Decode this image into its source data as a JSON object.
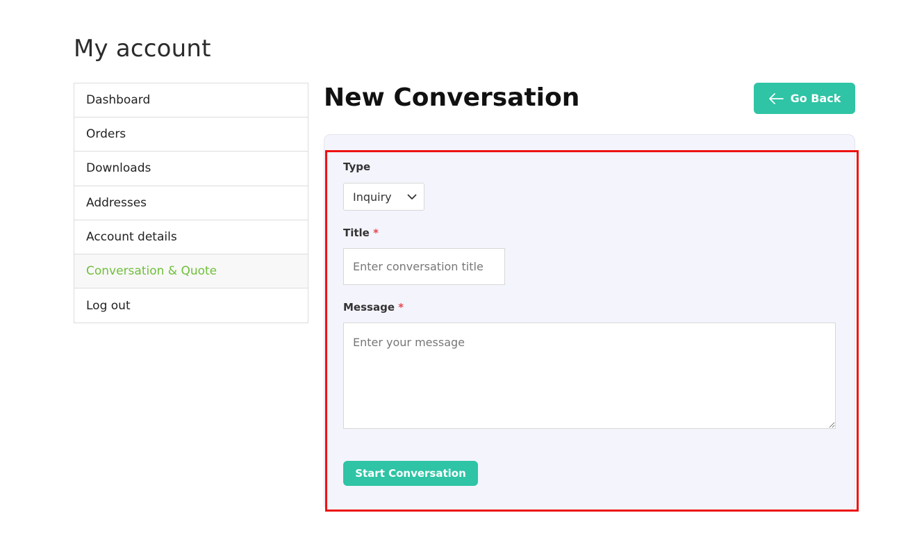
{
  "page": {
    "title": "My account"
  },
  "sidebar": {
    "items": [
      {
        "label": "Dashboard"
      },
      {
        "label": "Orders"
      },
      {
        "label": "Downloads"
      },
      {
        "label": "Addresses"
      },
      {
        "label": "Account details"
      },
      {
        "label": "Conversation & Quote",
        "active": true
      },
      {
        "label": "Log out"
      }
    ]
  },
  "main": {
    "heading": "New Conversation",
    "go_back_label": "Go Back",
    "go_back_icon": "arrow-left-icon"
  },
  "form": {
    "type": {
      "label": "Type",
      "selected": "Inquiry",
      "icon": "chevron-down-icon"
    },
    "title": {
      "label": "Title",
      "required_mark": "*",
      "placeholder": "Enter conversation title",
      "value": ""
    },
    "message": {
      "label": "Message",
      "required_mark": "*",
      "placeholder": "Enter your message",
      "value": ""
    },
    "submit_label": "Start Conversation"
  },
  "colors": {
    "accent": "#2ec4a5",
    "active_nav": "#6fbf3a",
    "required": "#e5484d",
    "highlight": "#ee1111",
    "panel_bg": "#f4f4fd"
  }
}
